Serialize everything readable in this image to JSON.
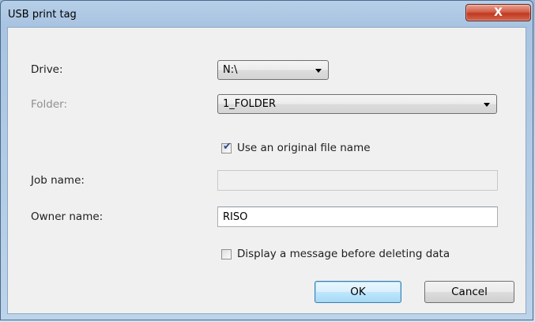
{
  "window": {
    "title": "USB print tag",
    "close_glyph": "X"
  },
  "form": {
    "drive": {
      "label": "Drive:",
      "value": "N:\\"
    },
    "folder": {
      "label": "Folder:",
      "value": "1_FOLDER"
    },
    "use_original": {
      "label": "Use an original file name",
      "checked": true
    },
    "job_name": {
      "label": "Job name:",
      "value": ""
    },
    "owner_name": {
      "label": "Owner name:",
      "value": "RISO"
    },
    "display_message": {
      "label": "Display a message before deleting data",
      "checked": false
    }
  },
  "buttons": {
    "ok": "OK",
    "cancel": "Cancel"
  },
  "colors": {
    "close_button": "#c0391f",
    "window_frame": "#a9c4e2",
    "check": "#2a4e8c"
  }
}
